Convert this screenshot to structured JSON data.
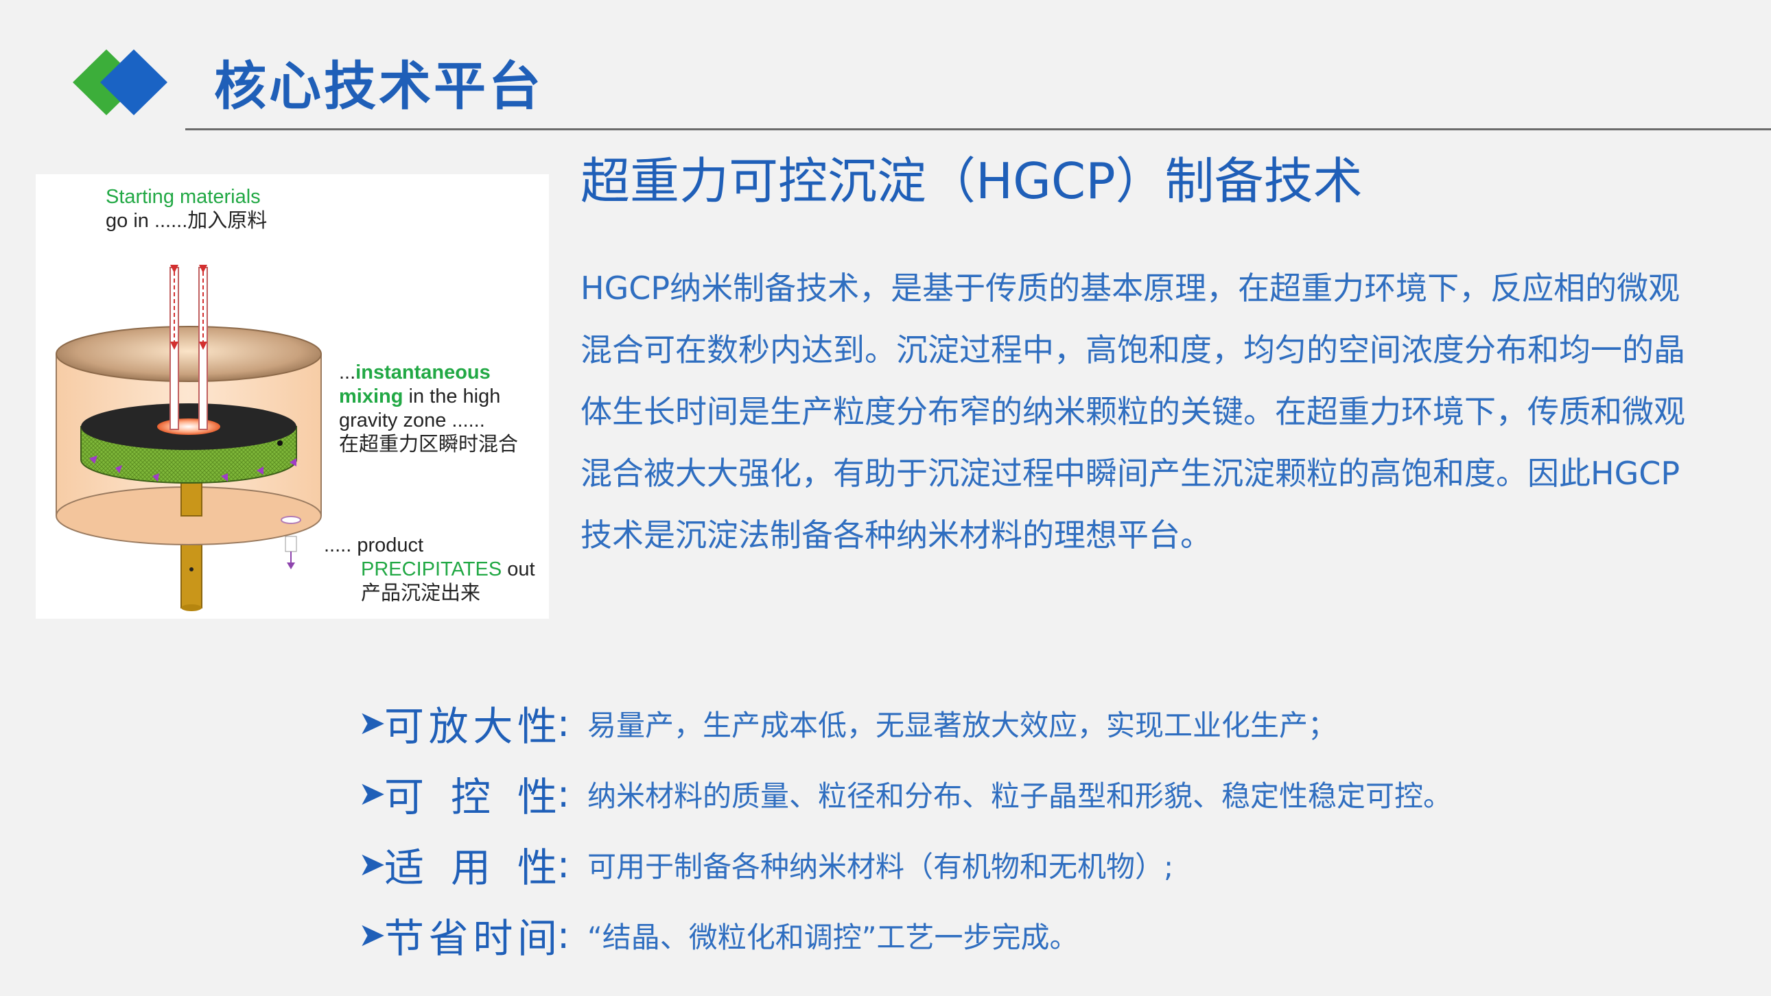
{
  "header": {
    "title": "核心技术平台",
    "accent_blue": "#1a63c4",
    "accent_green": "#3cae3a"
  },
  "figure": {
    "label_top_line1": "Starting materials",
    "label_top_line2": "go in ......加入原料",
    "label_mid_prefix": "...",
    "label_mid_bold1": "instantaneous",
    "label_mid_bold2": "mixing",
    "label_mid_rest2": " in the high",
    "label_mid_line3": "gravity zone ......",
    "label_mid_line4": "在超重力区瞬时混合",
    "label_bottom_line1": "..... product",
    "label_bottom_green": "PRECIPITATES",
    "label_bottom_rest": " out",
    "label_bottom_line3": "产品沉淀出来"
  },
  "section": {
    "title": "超重力可控沉淀（HGCP）制备技术",
    "paragraph": "HGCP纳米制备技术，是基于传质的基本原理，在超重力环境下，反应相的微观混合可在数秒内达到。沉淀过程中，高饱和度，均匀的空间浓度分布和均一的晶体生长时间是生产粒度分布窄的纳米颗粒的关键。在超重力环境下，传质和微观混合被大大强化，有助于沉淀过程中瞬间产生沉淀颗粒的高饱和度。因此HGCP技术是沉淀法制备各种纳米材料的理想平台。"
  },
  "features": [
    {
      "arrow": "➤",
      "name": "可放大性",
      "colon": ":",
      "desc": "易量产，生产成本低，无显著放大效应，实现工业化生产；"
    },
    {
      "arrow": "➤",
      "name": "可控性",
      "colon": ":",
      "desc": "纳米材料的质量、粒径和分布、粒子晶型和形貌、稳定性稳定可控。"
    },
    {
      "arrow": "➤",
      "name": "适用性",
      "colon": ":",
      "desc": "可用于制备各种纳米材料（有机物和无机物）;"
    },
    {
      "arrow": "➤",
      "name": "节省时间",
      "colon": ":",
      "desc": " “结晶、微粒化和调控”工艺一步完成。"
    }
  ]
}
